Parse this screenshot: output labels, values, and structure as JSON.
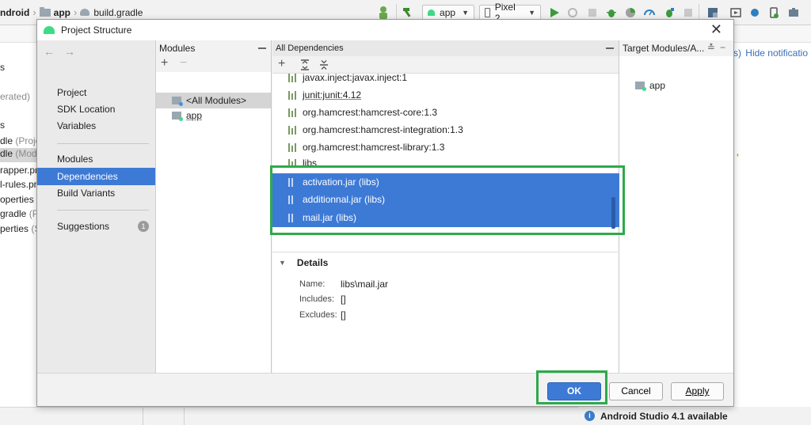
{
  "ide": {
    "breadcrumb": [
      "ndroid",
      "app",
      "build.gradle"
    ],
    "run_config": "app",
    "device": "Pixel 2",
    "hide_notifications": "Hide notificatio",
    "partial_link": "s)",
    "left_tree": [
      {
        "text": "s",
        "muted": ""
      },
      {
        "text": "",
        "muted": "erated)"
      },
      {
        "text": "s",
        "muted": ""
      },
      {
        "text": "dle",
        "muted": " (Projec"
      },
      {
        "text": "dle",
        "muted": " (Modu"
      },
      {
        "text": "rapper.pro",
        "muted": ""
      },
      {
        "text": "l-rules.pro",
        "muted": ""
      },
      {
        "text": "operties",
        "muted": " ("
      },
      {
        "text": "gradle",
        "muted": " (Pro"
      },
      {
        "text": "perties",
        "muted": " (SD"
      }
    ],
    "editor_fragment": "'",
    "update_notice": "Android Studio 4.1 available"
  },
  "dialog": {
    "title": "Project Structure",
    "nav": {
      "items": [
        {
          "label": "Project"
        },
        {
          "label": "SDK Location"
        },
        {
          "label": "Variables"
        },
        {
          "label": "Modules"
        },
        {
          "label": "Dependencies",
          "selected": true
        },
        {
          "label": "Build Variants"
        },
        {
          "label": "Suggestions",
          "badge": "1"
        }
      ]
    },
    "modules": {
      "header": "Modules",
      "items": [
        "<All Modules>",
        "app"
      ]
    },
    "dependencies": {
      "header": "All Dependencies",
      "items": [
        {
          "label": "javax.inject:javax.inject:1",
          "selected": false
        },
        {
          "label": "junit:junit:4.12",
          "selected": false
        },
        {
          "label": "org.hamcrest:hamcrest-core:1.3",
          "selected": false
        },
        {
          "label": "org.hamcrest:hamcrest-integration:1.3",
          "selected": false
        },
        {
          "label": "org.hamcrest:hamcrest-library:1.3",
          "selected": false
        },
        {
          "label": "libs",
          "selected": false
        },
        {
          "label": "activation.jar (libs)",
          "selected": true
        },
        {
          "label": "additionnal.jar (libs)",
          "selected": true
        },
        {
          "label": "mail.jar (libs)",
          "selected": true
        }
      ]
    },
    "details": {
      "header": "Details",
      "name_label": "Name:",
      "name_value": "libs\\mail.jar",
      "includes_label": "Includes:",
      "includes_value": "[]",
      "excludes_label": "Excludes:",
      "excludes_value": "[]"
    },
    "target": {
      "header": "Target Modules/A...",
      "items": [
        "app"
      ]
    },
    "buttons": {
      "ok": "OK",
      "cancel": "Cancel",
      "apply": "Apply"
    }
  },
  "colors": {
    "selection": "#3d7ad6",
    "highlight_box": "#2eaa4a"
  }
}
